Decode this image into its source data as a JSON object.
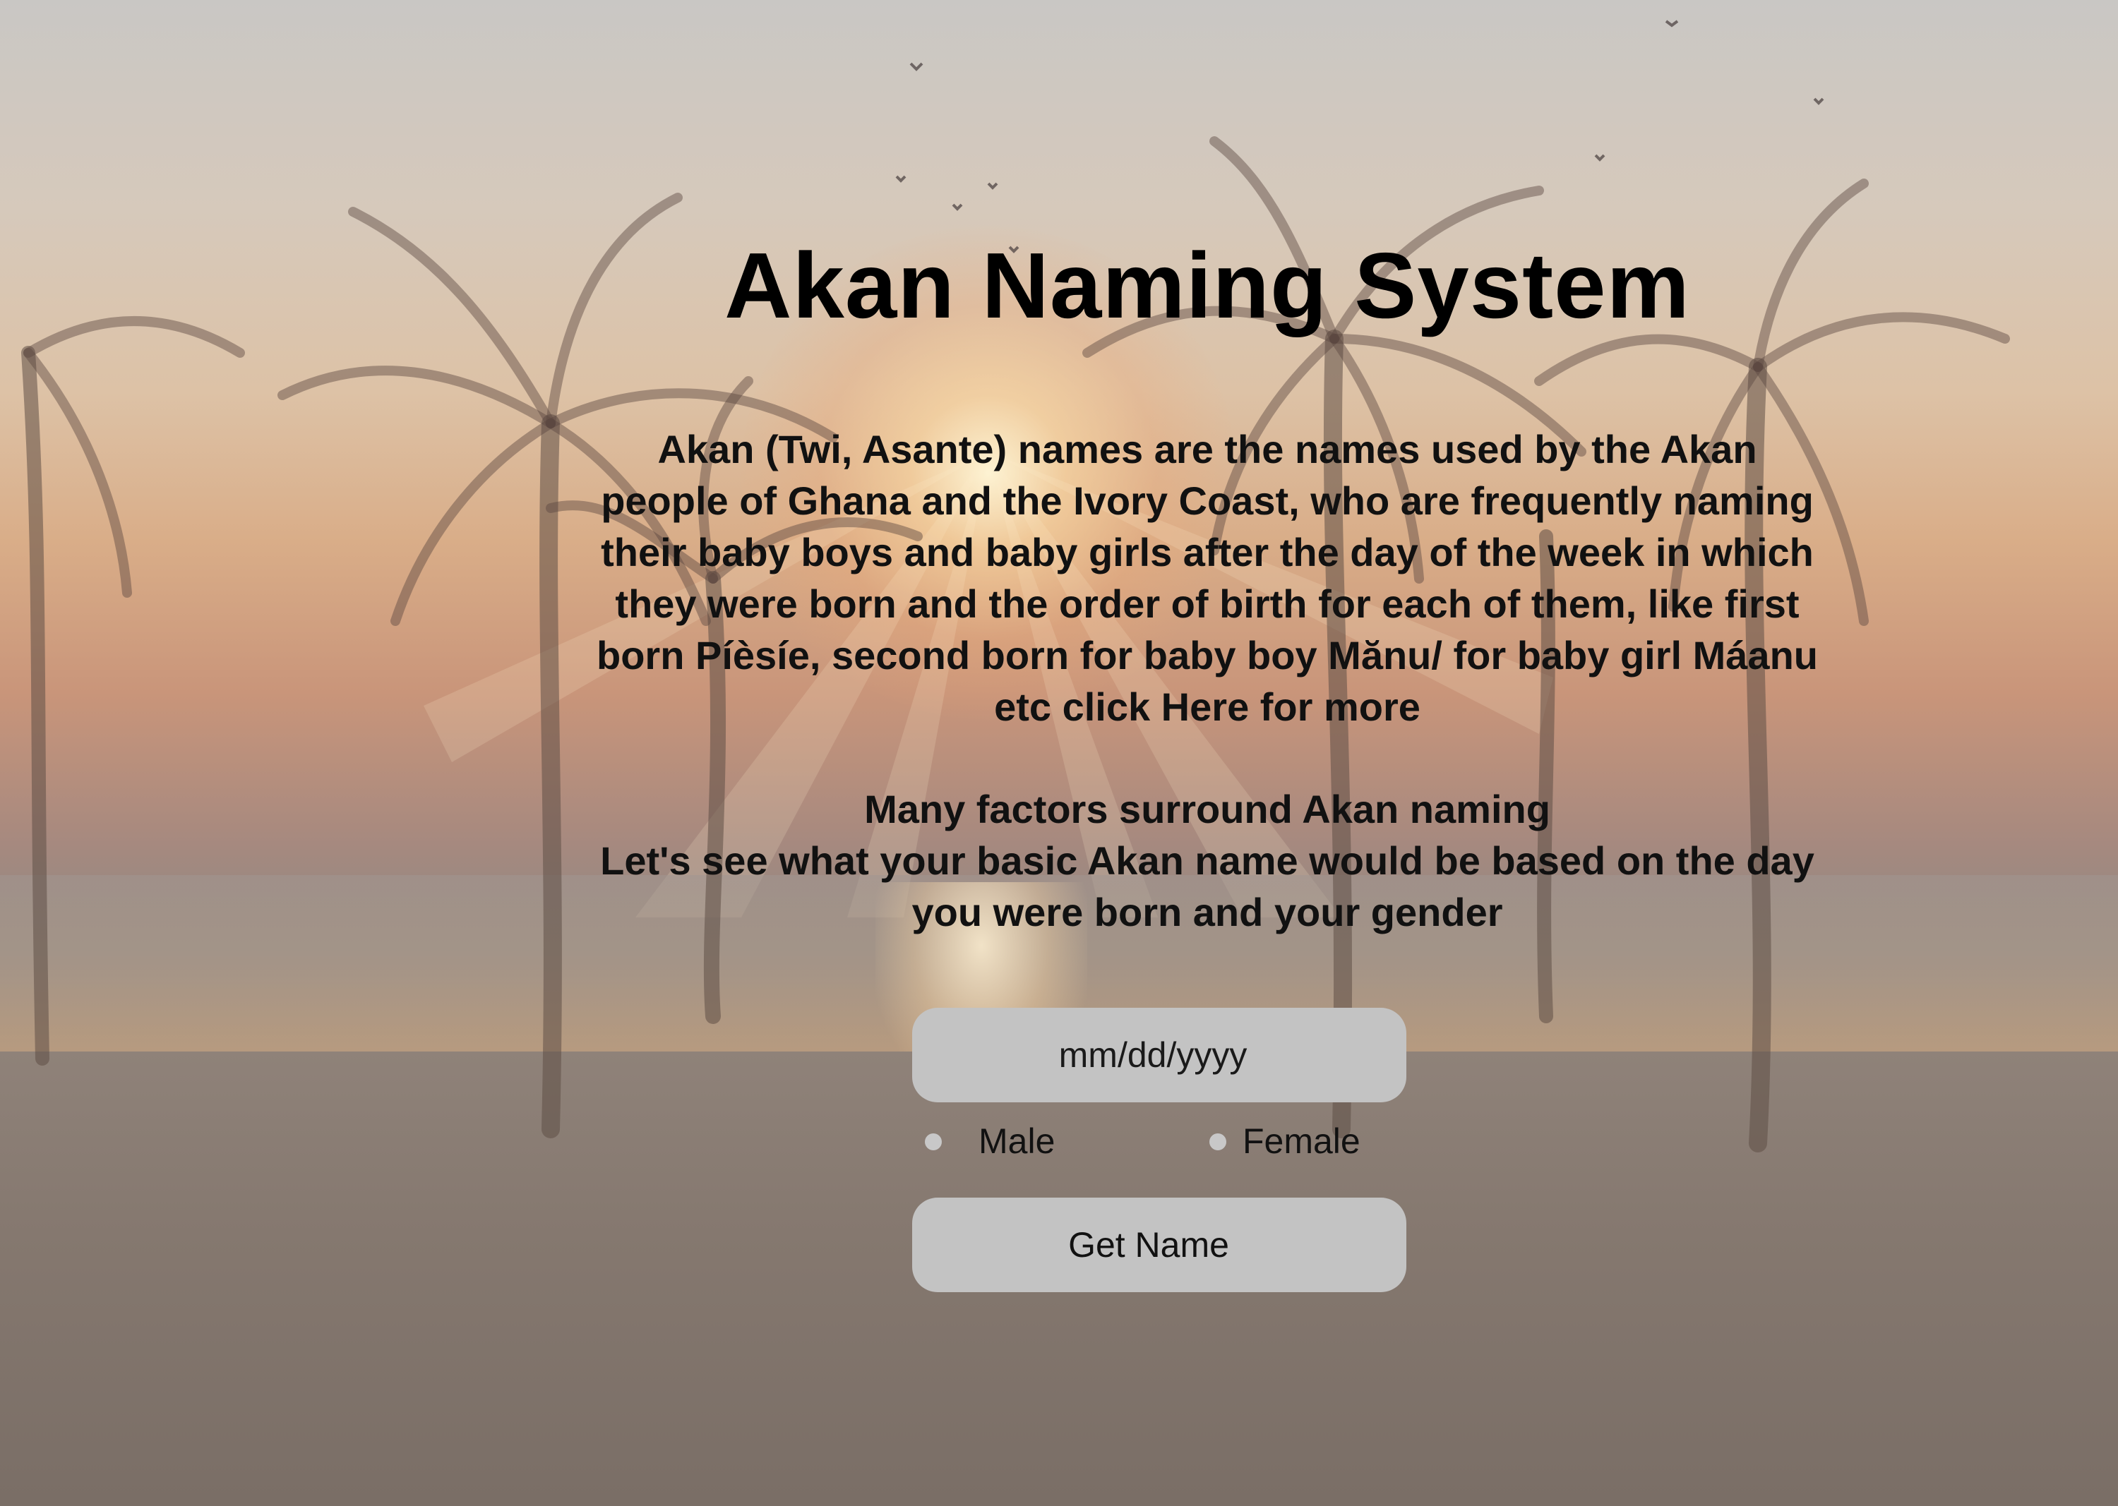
{
  "page": {
    "title": "Akan Naming System"
  },
  "intro": {
    "lines": [
      "Akan (Twi, Asante) names are the names used by the Akan",
      "people of Ghana and the Ivory Coast, who are frequently naming",
      "their baby boys and baby girls after the day of the week in which",
      "they were born and the order of birth for each of them, like first",
      "born Píèsíe, second born for baby boy Mănu/ for baby girl Máanu",
      "etc click Here for more"
    ]
  },
  "factors": {
    "lines": [
      "Many factors surround Akan naming",
      "Let's see what your basic Akan name would be based on the day",
      "you were born and your gender"
    ]
  },
  "form": {
    "date_placeholder": "mm/dd/yyyy",
    "gender_options": [
      "Male",
      "Female"
    ],
    "submit_label": "Get Name"
  },
  "colors": {
    "input_background": "#c3c3c3",
    "text": "#111111"
  },
  "icons": {
    "background": "palm-beach-sunset-image"
  }
}
